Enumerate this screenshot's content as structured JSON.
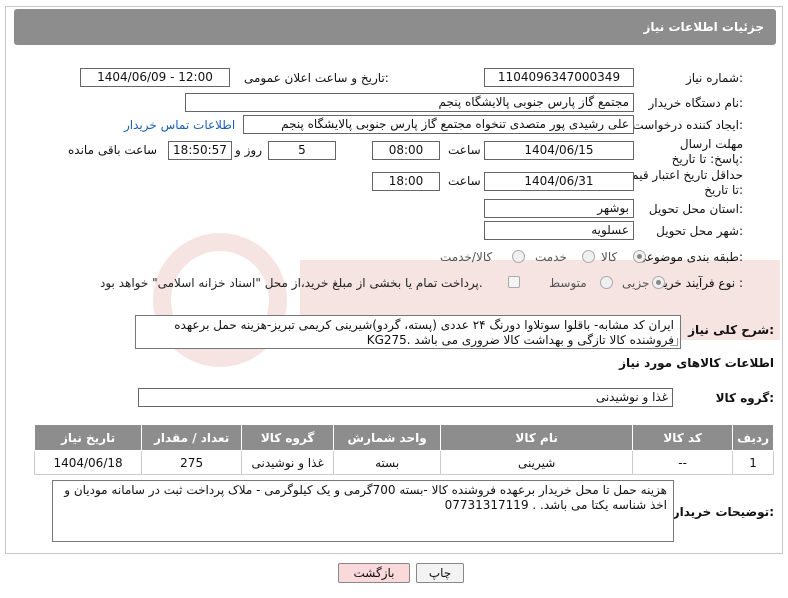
{
  "header": {
    "title": "جزئیات اطلاعات نیاز"
  },
  "fields": {
    "need_number_label": "شماره نیاز:",
    "need_number": "1104096347000349",
    "announce_label": "تاریخ و ساعت اعلان عمومی:",
    "announce_value": "1404/06/09 - 12:00",
    "buyer_org_label": "نام دستگاه خریدار:",
    "buyer_org": "مجتمع گاز پارس جنوبی  پالایشگاه پنجم",
    "creator_label": "ایجاد کننده درخواست:",
    "creator": "علی رشیدی پور متصدی تنخواه مجتمع گاز پارس جنوبی  پالایشگاه پنجم",
    "contact_link": "اطلاعات تماس خریدار",
    "deadline_label": "مهلت ارسال پاسخ: تا تاریخ:",
    "deadline_date": "1404/06/15",
    "time_label": "ساعت",
    "deadline_time": "08:00",
    "days_value": "5",
    "days_label": "روز و",
    "remaining_time": "18:50:57",
    "remaining_label": "ساعت باقی مانده",
    "price_valid_label": "حداقل تاریخ اعتبار قیمت: تا تاریخ:",
    "price_valid_date": "1404/06/31",
    "price_valid_time": "18:00",
    "province_label": "استان محل تحویل:",
    "province": "بوشهر",
    "city_label": "شهر محل تحویل:",
    "city": "عسلویه",
    "category_label": "طبقه بندی موضوعی:",
    "category_options": [
      "کالا",
      "خدمت",
      "کالا/خدمت"
    ],
    "category_selected": "کالا",
    "process_label": "نوع فرآیند خرید :",
    "process_options": [
      "جزیی",
      "متوسط"
    ],
    "process_selected": "جزیی",
    "payment_note": "پرداخت تمام یا بخشی از مبلغ خرید،از محل \"اسناد خزانه اسلامی\" خواهد بود."
  },
  "description": {
    "label": "شرح کلی نیاز:",
    "text": "ایران کد مشابه- باقلوا سوتلاوا دورنگ ۲۴ عددی (پسته، گردو)شیرینی کریمی تبریز-هزینه حمل برعهده فروشنده کالا تازگی و بهداشت کالا ضروری می باشد .KG275"
  },
  "goods_info": {
    "title": "اطلاعات کالاهای مورد نیاز",
    "group_label": "گروه کالا:",
    "group_value": "غذا و نوشیدنی"
  },
  "table": {
    "headers": [
      "ردیف",
      "کد کالا",
      "نام کالا",
      "واحد شمارش",
      "گروه کالا",
      "تعداد / مقدار",
      "تاریخ نیاز"
    ],
    "rows": [
      [
        "1",
        "--",
        "شیرینی",
        "بسته",
        "غذا و نوشیدنی",
        "275",
        "1404/06/18"
      ]
    ]
  },
  "buyer_notes": {
    "label": "توضیحات خریدار:",
    "text": "هزینه حمل تا محل خریدار برعهده فروشنده کالا -بسته 700گرمی و یک کیلوگرمی - ملاک پرداخت ثبت در سامانه مودیان و اخذ شناسه یکتا می باشد. . 07731317119"
  },
  "buttons": {
    "print": "چاپ",
    "back": "بازگشت"
  },
  "colors": {
    "header_bg": "#8d8d8d",
    "link": "#1a5fb4",
    "back_button_bg": "#f9d9d9"
  }
}
